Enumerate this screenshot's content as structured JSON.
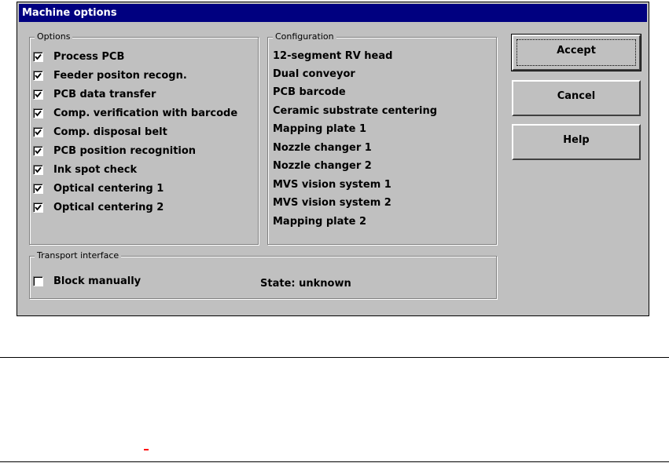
{
  "dialog": {
    "title": "Machine options",
    "options_legend": "Options",
    "options": [
      {
        "label": "Process PCB",
        "checked": true
      },
      {
        "label": "Feeder positon recogn.",
        "checked": true
      },
      {
        "label": "PCB data transfer",
        "checked": true
      },
      {
        "label": "Comp. verification with barcode",
        "checked": true
      },
      {
        "label": "Comp. disposal belt",
        "checked": true
      },
      {
        "label": "PCB position recognition",
        "checked": true
      },
      {
        "label": "Ink spot check",
        "checked": true
      },
      {
        "label": "Optical centering 1",
        "checked": true
      },
      {
        "label": "Optical centering 2",
        "checked": true
      }
    ],
    "configuration_legend": "Configuration",
    "configuration": [
      "12-segment RV head",
      "Dual conveyor",
      "PCB barcode",
      "Ceramic substrate centering",
      "Mapping plate 1",
      "Nozzle changer 1",
      "Nozzle changer 2",
      "MVS vision system 1",
      "MVS vision system 2",
      "Mapping plate 2"
    ],
    "transport_legend": "Transport interface",
    "block_manually": {
      "label": "Block manually",
      "checked": false
    },
    "state_text": "State: unknown",
    "buttons": {
      "accept": "Accept",
      "cancel": "Cancel",
      "help": "Help"
    }
  },
  "colors": {
    "titlebar": "#000080",
    "face": "#c0c0c0",
    "marker": "#ff0000"
  }
}
